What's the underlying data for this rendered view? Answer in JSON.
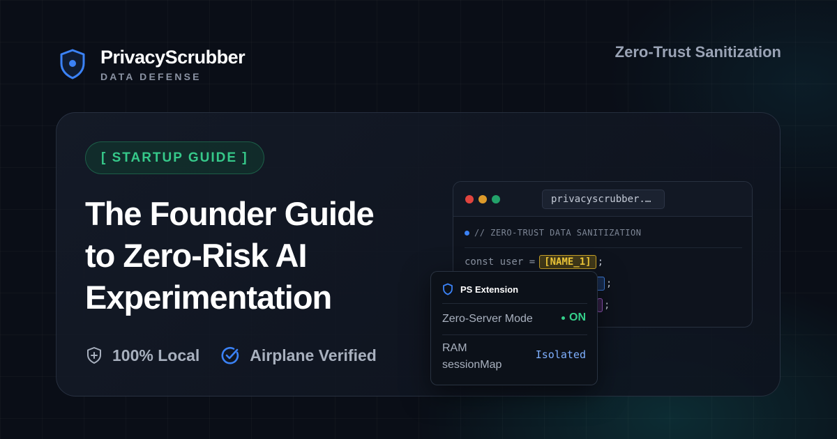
{
  "brand": {
    "name": "PrivacyScrubber",
    "tagline": "DATA DEFENSE"
  },
  "header": {
    "right_title": "Zero-Trust Sanitization"
  },
  "card": {
    "badge": "[ STARTUP GUIDE ]",
    "headline_lines": [
      "The Founder Guide",
      "to Zero-Risk AI",
      "Experimentation"
    ],
    "features": [
      {
        "label": "100% Local",
        "icon": "shield-plus-icon"
      },
      {
        "label": "Airplane Verified",
        "icon": "check-circle-icon"
      }
    ]
  },
  "code_window": {
    "url": "privacyscrubber.…",
    "comment": "// ZERO-TRUST DATA SANITIZATION",
    "line1_prefix": "const user = ",
    "line1_token": "[NAME_1]",
    "line2_token": "1]",
    "line3_token": "",
    "semicolon": ";"
  },
  "popup": {
    "title": "PS Extension",
    "mode_label": "Zero-Server Mode",
    "mode_value": "ON",
    "ram_label_1": "RAM",
    "ram_label_2": "sessionMap",
    "ram_value": "Isolated"
  },
  "colors": {
    "accent_green": "#36c98a",
    "accent_blue": "#3b82f6",
    "token_yellow": "#f5cd3a"
  }
}
